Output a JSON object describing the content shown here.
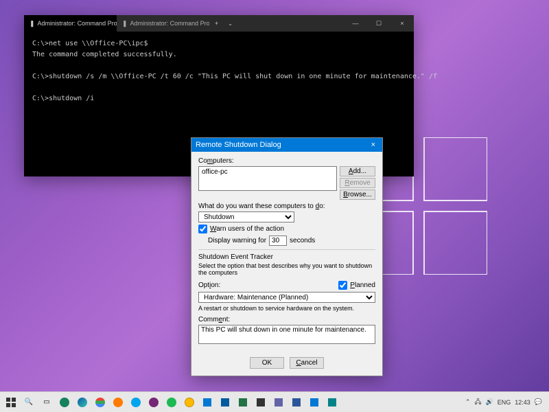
{
  "terminal": {
    "tab1": "Administrator: Command Prom",
    "tab2": "Administrator: Command Prom",
    "line1": "C:\\>net use \\\\Office-PC\\ipc$",
    "line2": "The command completed successfully.",
    "line3": "C:\\>shutdown /s /m \\\\Office-PC /t 60 /c \"This PC will shut down in one minute for maintenance.\" /f",
    "line4": "C:\\>shutdown /i"
  },
  "dialog": {
    "title": "Remote Shutdown Dialog",
    "computers_label": "Computers:",
    "computer_value": "office-pc",
    "add": "Add...",
    "remove": "Remove",
    "browse": "Browse...",
    "action_label": "What do you want these computers to do:",
    "action_value": "Shutdown",
    "warn_label": "Warn users of the action",
    "display_label": "Display warning for",
    "display_value": "30",
    "seconds": "seconds",
    "tracker_title": "Shutdown Event Tracker",
    "tracker_desc": "Select the option that best describes why you want to shutdown the computers",
    "option_label": "Option:",
    "planned_label": "Planned",
    "option_value": "Hardware: Maintenance (Planned)",
    "option_desc": "A restart or shutdown to service hardware on the system.",
    "comment_label": "Comment:",
    "comment_value": "This PC will shut down in one minute for maintenance.",
    "ok": "OK",
    "cancel": "Cancel"
  },
  "tray": {
    "time": "12:43",
    "lang": "ENG",
    "chevron": "⌃"
  }
}
